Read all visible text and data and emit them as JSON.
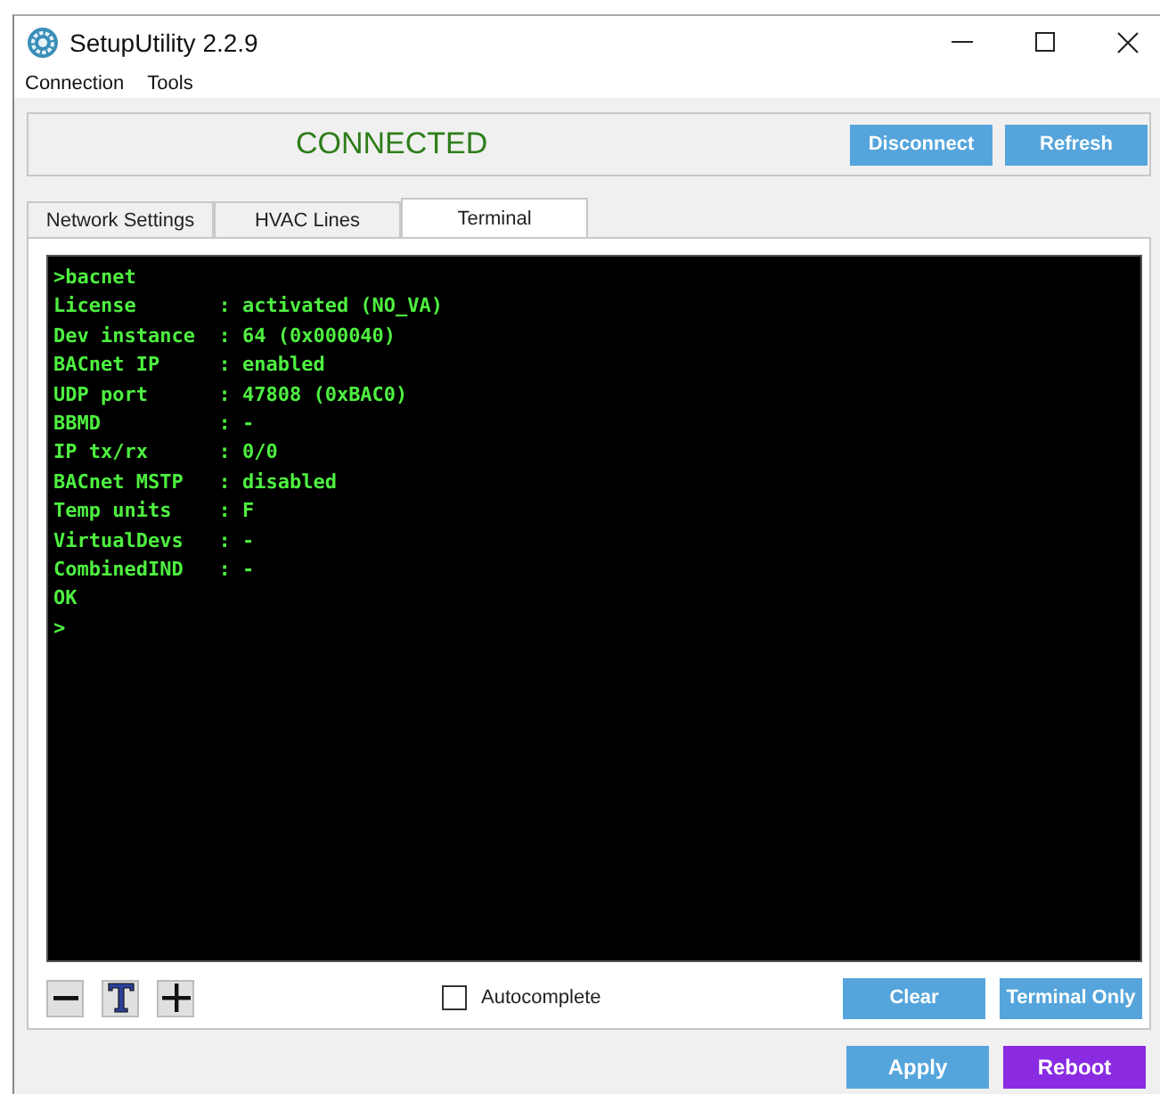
{
  "window": {
    "title": "SetupUtility 2.2.9"
  },
  "menu": [
    {
      "label": "Connection"
    },
    {
      "label": "Tools"
    }
  ],
  "status": {
    "text": "CONNECTED",
    "buttons": [
      "Disconnect",
      "Refresh"
    ]
  },
  "tabs": [
    {
      "label": "Network Settings",
      "selected": false
    },
    {
      "label": "HVAC Lines",
      "selected": false
    },
    {
      "label": "Terminal",
      "selected": true
    }
  ],
  "terminal": {
    "lines": [
      ">bacnet",
      "License       : activated (NO_VA)",
      "Dev instance  : 64 (0x000040)",
      "BACnet IP     : enabled",
      "UDP port      : 47808 (0xBAC0)",
      "BBMD          : -",
      "IP tx/rx      : 0/0",
      "BACnet MSTP   : disabled",
      "Temp units    : F",
      "VirtualDevs   : -",
      "CombinedIND   : -",
      "OK",
      ">"
    ]
  },
  "terminal_controls": {
    "autocomplete": {
      "label": "Autocomplete",
      "checked": false
    },
    "buttons": [
      "Clear",
      "Terminal Only"
    ]
  },
  "footer_buttons": [
    {
      "label": "Apply",
      "kind": "normal"
    },
    {
      "label": "Reboot",
      "kind": "danger"
    }
  ]
}
